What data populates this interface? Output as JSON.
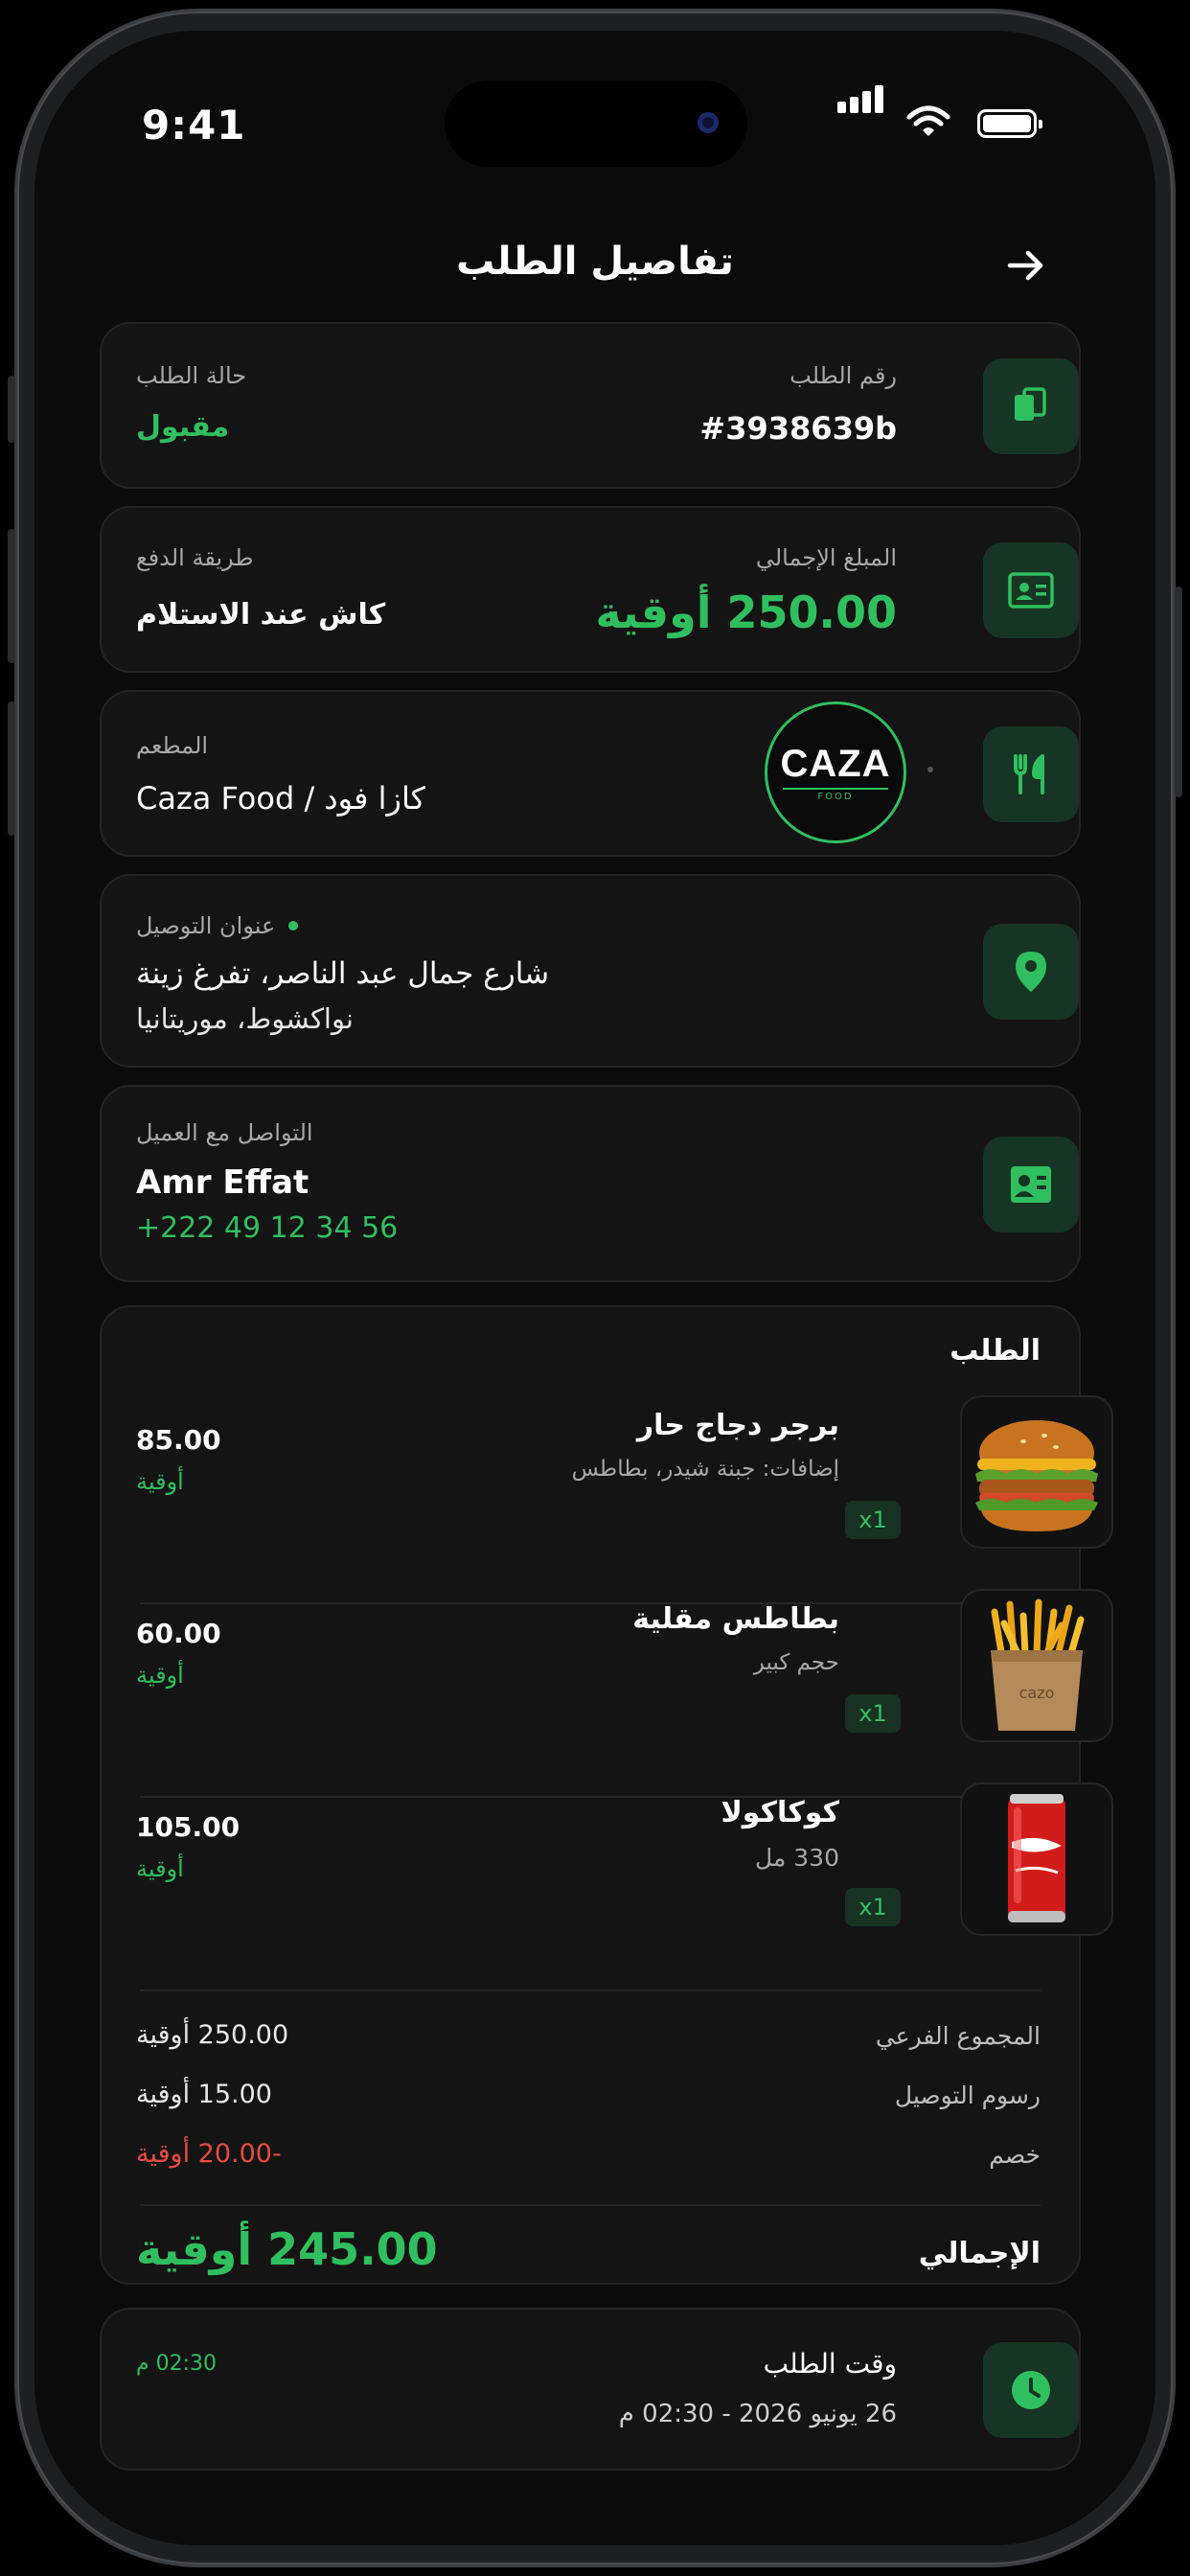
{
  "status_bar": {
    "time": "9:41"
  },
  "header": {
    "title": "تفاصيل الطلب"
  },
  "order_info": {
    "number_label": "رقم الطلب",
    "number": "#3938639b",
    "status_label": "حالة الطلب",
    "status": "مقبول"
  },
  "payment": {
    "total_label": "المبلغ الإجمالي",
    "total": "250.00 أوقية",
    "method_label": "طريقة الدفع",
    "method": "كاش عند الاستلام"
  },
  "restaurant": {
    "label": "المطعم",
    "name": "Caza Food / كازا فود",
    "logo_text": "CAZA",
    "logo_sub": "FOOD"
  },
  "address": {
    "label": "عنوان التوصيل",
    "line1": "شارع جمال عبد الناصر، تفرغ زينة",
    "line2": "نواكشوط، موريتانيا"
  },
  "customer": {
    "label": "التواصل مع العميل",
    "name": "Amr Effat",
    "phone": "+222 49 12 34 56"
  },
  "order": {
    "title": "الطلب",
    "items": [
      {
        "name": "برجر دجاج حار",
        "details": "إضافات: جبنة شيدر، بطاطس",
        "qty": "x1",
        "price": "85.00",
        "currency": "أوقية",
        "image": "burger"
      },
      {
        "name": "بطاطس مقلية",
        "details": "حجم كبير",
        "qty": "x1",
        "price": "60.00",
        "currency": "أوقية",
        "image": "fries",
        "image_text": "cazo"
      },
      {
        "name": "كوكاكولا",
        "details": "330 مل",
        "qty": "x1",
        "price": "105.00",
        "currency": "أوقية",
        "image": "coca-cola-can"
      }
    ],
    "subtotal_label": "المجموع الفرعي",
    "subtotal": "250.00 أوقية",
    "delivery_label": "رسوم التوصيل",
    "delivery": "15.00 أوقية",
    "discount_label": "خصم",
    "discount": "-20.00 أوقية",
    "total_label": "الإجمالي",
    "total": "245.00 أوقية"
  },
  "order_time": {
    "label": "وقت الطلب",
    "date": "26 يونيو 2026 - 02:30 م",
    "time_badge": "02:30 م"
  },
  "colors": {
    "accent": "#2fbf5e",
    "danger": "#e84a3f",
    "card_bg": "#141414",
    "icon_bg": "#163524",
    "screen_bg": "#0b0b0b"
  },
  "icons": [
    "arrow-right-icon",
    "copy-icon",
    "id-card-icon",
    "fork-knife-icon",
    "location-pin-icon",
    "contact-card-icon",
    "clock-icon"
  ]
}
